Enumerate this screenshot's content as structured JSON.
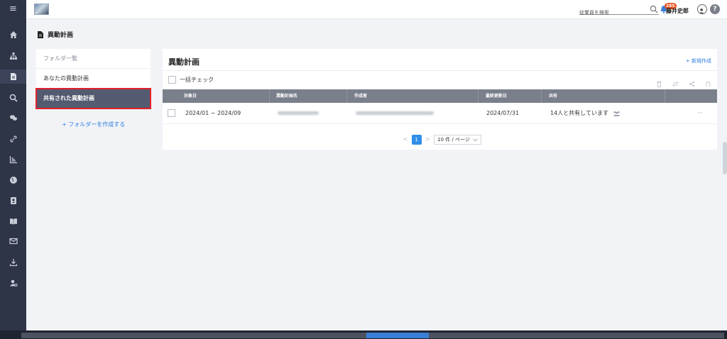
{
  "topbar": {
    "search_placeholder": "従業員を検索",
    "notification_count": "285",
    "user_name": "藤井史郎",
    "help_label": "?"
  },
  "sidebar": {
    "menu_icon": "≡",
    "icons": [
      "home-icon",
      "org-chart-icon",
      "document-icon",
      "search-icon",
      "chat-icon",
      "link-icon",
      "chart-icon",
      "globe-icon",
      "contact-card-icon",
      "book-icon",
      "mail-icon",
      "download-icon",
      "user-settings-icon"
    ]
  },
  "page": {
    "title": "異動計画"
  },
  "folders": {
    "header": "フォルダ一覧",
    "items": [
      {
        "label": "あなたの異動計画"
      },
      {
        "label": "共有された異動計画"
      }
    ],
    "create_label": "+ フォルダーを作成する"
  },
  "main": {
    "title": "異動計画",
    "new_button": "+ 新規作成",
    "bulk_check": "一括チェック",
    "columns": [
      "対象日",
      "異動計画名",
      "作成者",
      "最終更新日",
      "共有"
    ],
    "rows": [
      {
        "period": "2024/01 ~ 2024/09",
        "updated": "2024/07/31",
        "shared": "14人と共有しています",
        "menu": "···"
      }
    ],
    "pagination": {
      "prev": "<",
      "current": "1",
      "next": ">",
      "page_size": "10 件 / ページ"
    }
  },
  "colors": {
    "accent": "#2f7fe0",
    "sidebar_bg": "#2e3547",
    "selected_bg": "#545b70",
    "highlight_border": "#e3202a"
  }
}
